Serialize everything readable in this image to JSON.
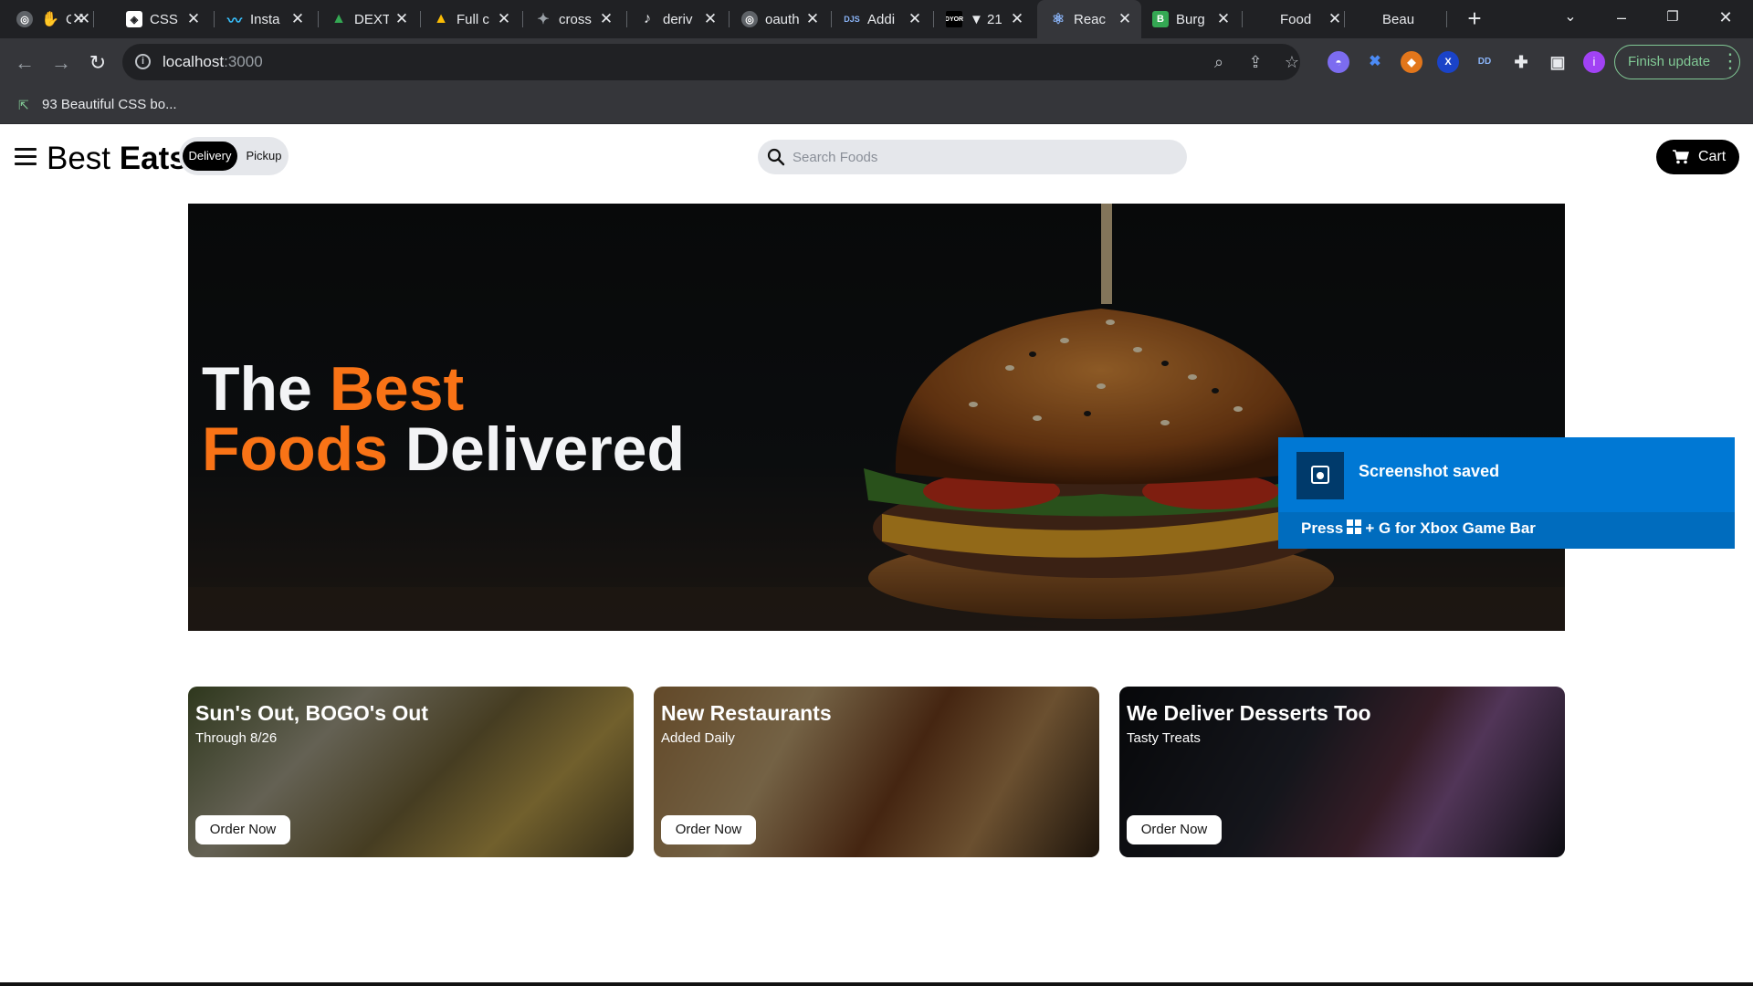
{
  "browser": {
    "tabs": [
      {
        "title": "",
        "icon": "globe-icon",
        "color": "#5f6368"
      },
      {
        "title": "C",
        "icon": "hand-icon",
        "color": "#f9ab00"
      },
      {
        "title": "CSS I",
        "icon": "codepen-icon",
        "color": "#202124"
      },
      {
        "title": "Insta",
        "icon": "tailwind-icon",
        "color": "#38bdf8"
      },
      {
        "title": "DEXT",
        "icon": "drive-icon",
        "color": "#1e8e3e"
      },
      {
        "title": "Full c",
        "icon": "drive-icon",
        "color": "#f9ab00"
      },
      {
        "title": "cross",
        "icon": "puzzle-icon",
        "color": "#9aa0a6"
      },
      {
        "title": "deriv",
        "icon": "tiktok-icon",
        "color": "#202124"
      },
      {
        "title": "oauth",
        "icon": "globe-icon",
        "color": "#5f6368"
      },
      {
        "title": "Addi",
        "icon": "dotjs-icon",
        "color": "#202124"
      },
      {
        "title": "▼ 21",
        "icon": "dyor-icon",
        "color": "#202124"
      },
      {
        "title": "Reac",
        "icon": "react-icon",
        "color": "#61dafb",
        "active": true
      },
      {
        "title": "Burg",
        "icon": "burger-icon",
        "color": "#34a853"
      },
      {
        "title": "Food",
        "icon": "blank-icon",
        "color": "#202124"
      },
      {
        "title": "Beau",
        "icon": "blank-icon",
        "color": "#202124"
      }
    ],
    "url_host": "localhost",
    "url_port": ":3000",
    "finish_update": "Finish update",
    "bookmark": "93 Beautiful CSS bo...",
    "profile_initial": "i",
    "ext_x": "X",
    "ext_dd": "DD"
  },
  "page": {
    "brand_light": "Best",
    "brand_bold": "Eats",
    "toggle_delivery": "Delivery",
    "toggle_pickup": "Pickup",
    "search_placeholder": "Search Foods",
    "cart_label": "Cart",
    "hero_line1_white": "The",
    "hero_line1_orange": "Best",
    "hero_line2_orange": "Foods",
    "hero_line2_white": "Delivered",
    "accent_color": "#f97316",
    "cards": [
      {
        "title": "Sun's Out, BOGO's Out",
        "subtitle": "Through 8/26",
        "button": "Order Now"
      },
      {
        "title": "New Restaurants",
        "subtitle": "Added Daily",
        "button": "Order Now"
      },
      {
        "title": "We Deliver Desserts Too",
        "subtitle": "Tasty Treats",
        "button": "Order Now"
      }
    ]
  },
  "toast": {
    "title": "Screenshot saved",
    "hint_pre": "Press",
    "hint_post": "+ G for Xbox Game Bar",
    "color": "#0078d4"
  }
}
